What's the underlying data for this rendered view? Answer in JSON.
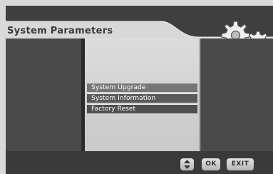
{
  "screen": {
    "title": "System Parameters"
  },
  "menu": {
    "items": [
      {
        "label": "System Upgrade"
      },
      {
        "label": "System  Information"
      },
      {
        "label": "Factory Reset"
      }
    ]
  },
  "footer": {
    "nav_icon": "up-down-arrows-icon",
    "ok_label": "OK",
    "exit_label": "EXIT"
  },
  "colors": {
    "background": "#3f3f3f",
    "center_panel": "#d4d4d4",
    "highlight": "#767676"
  }
}
